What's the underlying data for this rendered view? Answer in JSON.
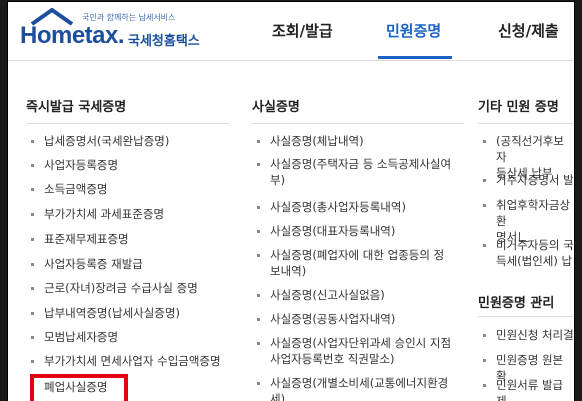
{
  "header": {
    "logo_small": "국민과 함께하는 납세서비스",
    "logo_word": "Hometax.",
    "logo_kr": "국세청홈택스",
    "nav": [
      "조회/발급",
      "민원증명",
      "신청/제출"
    ],
    "active_nav": "민원증명"
  },
  "col1": {
    "title": "즉시발급 국세증명",
    "items": [
      "납세증명서(국세완납증명)",
      "사업자등록증명",
      "소득금액증명",
      "부가가치세 과세표준증명",
      "표준재무제표증명",
      "사업자등록증 재발급",
      "근로(자녀)장려금 수급사실 증명",
      "납부내역증명(납세사실증명)",
      "모범납세자증명",
      "부가가치세 면세사업자 수입금액증명",
      "폐업사실증명"
    ]
  },
  "col2": {
    "title": "사실증명",
    "items": [
      [
        "사실증명(체납내역)"
      ],
      [
        "사실증명(주택자금 등 소득공제사실여",
        "부)"
      ],
      [
        "사실증명(총사업자등록내역)"
      ],
      [
        "사실증명(대표자등록내역)"
      ],
      [
        "사실증명(폐업자에 대한 업종등의 정",
        "보내역)"
      ],
      [
        "사실증명(신고사실없음)"
      ],
      [
        "사실증명(공동사업자내역)"
      ],
      [
        "사실증명(사업자단위과세 승인시 지점",
        "사업자등록번호 직권말소)"
      ],
      [
        "사실증명(개별소비세(교통에너지환경",
        "세)"
      ]
    ]
  },
  "col3": {
    "title": "기타 민원 증명",
    "items": [
      [
        "(공직선거후보자",
        "등산세 납부"
      ],
      [
        "거주자증명서 발"
      ],
      [
        "취업후학자금상환",
        "명서"
      ],
      [
        "비거주자등의 국",
        "득세(법인세) 납"
      ]
    ],
    "title2": "민원증명 관리",
    "items2": [
      "민원신청 처리결",
      "민원증명 원본 확",
      "민원서류 발급 제"
    ]
  }
}
